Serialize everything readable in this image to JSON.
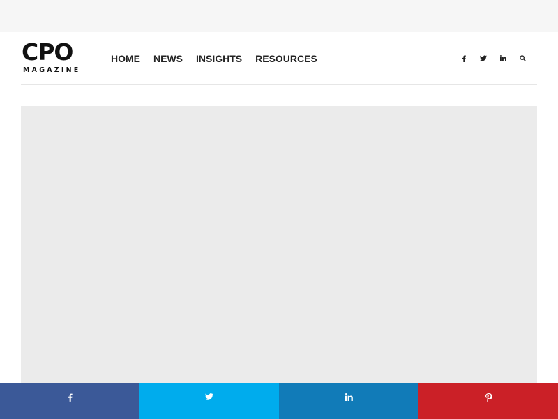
{
  "site": {
    "logo_main": "CPO",
    "logo_sub": "MAGAZINE"
  },
  "nav": {
    "items": [
      {
        "label": "HOME"
      },
      {
        "label": "NEWS"
      },
      {
        "label": "INSIGHTS"
      },
      {
        "label": "RESOURCES"
      }
    ]
  },
  "header_icons": [
    "facebook-icon",
    "twitter-icon",
    "linkedin-icon",
    "search-icon"
  ],
  "share_bar": {
    "buttons": [
      {
        "network": "facebook",
        "icon": "facebook-icon",
        "color": "#3b5998"
      },
      {
        "network": "twitter",
        "icon": "twitter-icon",
        "color": "#00aced"
      },
      {
        "network": "linkedin",
        "icon": "linkedin-icon",
        "color": "#117bb8"
      },
      {
        "network": "pinterest",
        "icon": "pinterest-icon",
        "color": "#cb2027"
      }
    ]
  },
  "colors": {
    "top_strip": "#f6f6f6",
    "banner_placeholder": "#ebebeb",
    "text_dark": "#222222"
  }
}
